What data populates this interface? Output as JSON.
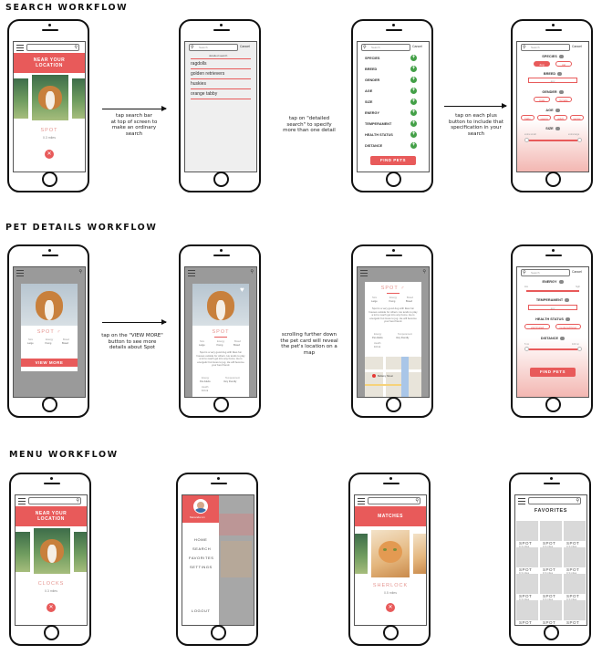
{
  "sections": {
    "search": "SEARCH WORKFLOW",
    "details": "PET DETAILS WORKFLOW",
    "menu": "MENU WORKFLOW"
  },
  "common": {
    "near_line1": "NEAR YOUR",
    "near_line2": "LOCATION",
    "cancel": "Cancel",
    "search_placeholder": "Search",
    "find_pets": "FIND PETS",
    "close_symbol": "✕",
    "male_symbol": "♂"
  },
  "search_workflow": {
    "s1": {
      "pet_name": "SPOT",
      "pet_dist": "0.3 miles"
    },
    "s2": {
      "detailed_search": "detailed search",
      "items": [
        "ragdolls",
        "golden retrievers",
        "huskies",
        "orange tabby"
      ]
    },
    "s3": {
      "criteria": [
        "SPECIES",
        "BREED",
        "GENDER",
        "AGE",
        "SIZE",
        "ENERGY",
        "TEMPERAMENT",
        "HEALTH STATUS",
        "DISTANCE"
      ]
    },
    "s4": {
      "species": "SPECIES",
      "species_opts": [
        "dog",
        "cat"
      ],
      "breed": "BREED",
      "breed_value": "any",
      "gender": "GENDER",
      "gender_opts": [
        "male",
        "female"
      ],
      "age": "AGE",
      "age_opts": [
        "baby",
        "young",
        "adult",
        "senior"
      ],
      "size": "SIZE",
      "size_min": "extra small",
      "size_max": "extra large"
    },
    "captions": [
      "tap search bar\nat top of screen to\nmake an ordinary\nsearch",
      "tap on \"detailed\nsearch\" to specify\nmore than one detail",
      "tap on each plus\nbutton to include that\nspecification in your\nsearch"
    ]
  },
  "details_workflow": {
    "pet_name": "SPOT",
    "view_more": "VIEW MORE",
    "stats_labels": [
      "Size",
      "Energy",
      "Breed"
    ],
    "stats_values": [
      "Large",
      "Young",
      "Breed"
    ],
    "stats2_labels": [
      "Energy",
      "Temperament",
      "Health"
    ],
    "stats2_values": [
      "Pet Adults",
      "Very friendly"
    ],
    "distance": "0.3 mi",
    "map_label": "Bellamy Street",
    "desc": "Spot is a very good dog with likes fun houses outside for others. He tends to play a lot to reach get into any home. He is energetic but loves to jog. He will become your best friend.",
    "d4": {
      "energy": "ENERGY",
      "energy_min": "low",
      "energy_max": "high",
      "temperament": "TEMPERAMENT",
      "temperament_value": "any",
      "health": "HEALTH STATUS",
      "health_opts": [
        "vaccinated",
        "neutered/spay"
      ],
      "distance": "DISTANCE",
      "distance_min": "5 mi",
      "distance_max": "100 mi"
    },
    "captions": [
      "tap on the \"VIEW MORE\"\nbutton to see more\ndetails about Spot",
      "scrolling further down\nthe pet card will reveal\nthe pet's location on a\nmap"
    ]
  },
  "menu_workflow": {
    "m1": {
      "pet_name": "CLOCKS",
      "pet_dist": "0.3 miles"
    },
    "m2": {
      "user_name": "Meranda Lin",
      "items": [
        "HOME",
        "SEARCH",
        "FAVORITES",
        "SETTINGS"
      ],
      "logout": "LOGOUT"
    },
    "m3": {
      "title": "MATCHES",
      "pet_name": "SHERLOCK",
      "pet_dist": "0.5 miles"
    },
    "m4": {
      "title": "FAVORITES",
      "cells": [
        {
          "name": "SPOT",
          "dist": "0.3 miles"
        },
        {
          "name": "SPOT",
          "dist": "0.3 miles"
        },
        {
          "name": "SPOT",
          "dist": "0.3 miles"
        },
        {
          "name": "SPOT",
          "dist": "0.3 miles"
        },
        {
          "name": "SPOT",
          "dist": "0.3 miles"
        },
        {
          "name": "SPOT",
          "dist": "0.3 miles"
        },
        {
          "name": "SPOT",
          "dist": "0.3 miles"
        },
        {
          "name": "SPOT",
          "dist": "0.3 miles"
        },
        {
          "name": "SPOT",
          "dist": "0.3 miles"
        },
        {
          "name": "SPOT",
          "dist": "0.3 miles"
        },
        {
          "name": "SPOT",
          "dist": "0.3 miles"
        },
        {
          "name": "SPOT",
          "dist": "0.3 miles"
        }
      ]
    }
  },
  "colors": {
    "accent": "#e85a5a",
    "plus": "#43a047",
    "overlay": "#9a9a9a"
  }
}
